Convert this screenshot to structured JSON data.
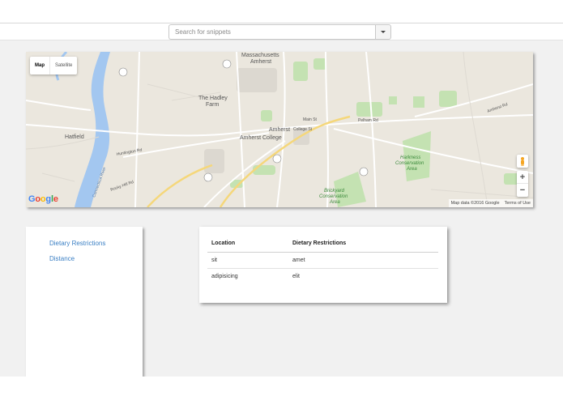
{
  "search": {
    "placeholder": "Search for snippets"
  },
  "map": {
    "type_buttons": {
      "map": "Map",
      "satellite": "Satellite"
    },
    "labels": {
      "massachusetts": "Massachusetts",
      "amherst_top": "Amherst",
      "hadley_farm_1": "The Hadley",
      "hadley_farm_2": "Farm",
      "amherst": "Amherst",
      "amherst_college": "Amherst College",
      "hatfield": "Hatfield",
      "harkness_1": "Harkness",
      "harkness_2": "Conservation",
      "harkness_3": "Area",
      "brickyard_1": "Brickyard",
      "brickyard_2": "Conservation",
      "brickyard_3": "Area",
      "college_st": "College St",
      "main_st": "Main St",
      "pelham_rd": "Pelham Rd",
      "amherst_rd": "Amherst Rd",
      "huntington_rd": "Huntington Rd",
      "rocky_hill_rd": "Rocky Hill Rd",
      "river": "Connecticut River"
    },
    "google": "Google",
    "attribution": "Map data ©2016 Google",
    "terms": "Terms of Use",
    "zoom_in": "+",
    "zoom_out": "−"
  },
  "sidebar": {
    "links": [
      "Dietary Restrictions",
      "Distance"
    ]
  },
  "table": {
    "headers": [
      "Location",
      "Dietary Restrictions"
    ],
    "rows": [
      [
        "sit",
        "amet"
      ],
      [
        "adipisicing",
        "elit"
      ]
    ]
  },
  "colors": {
    "link": "#3a7fc4",
    "water": "#a3c7f0",
    "park": "#b7dca4"
  }
}
